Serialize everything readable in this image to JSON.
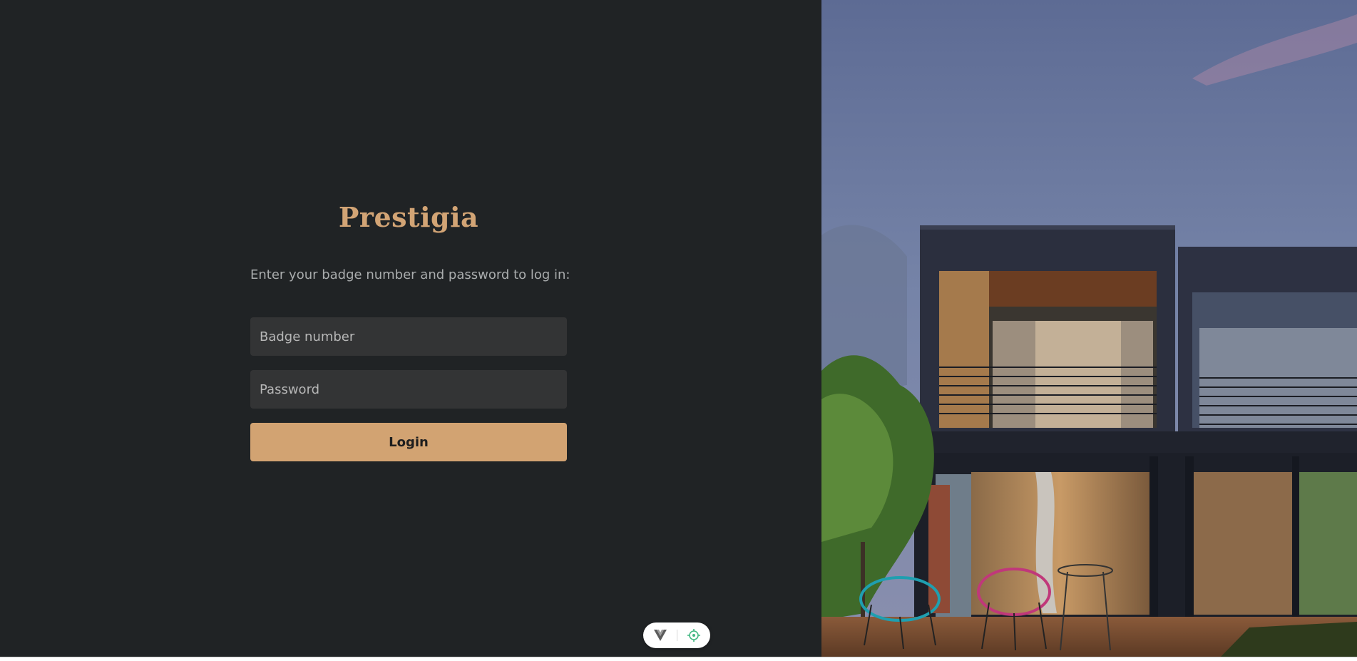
{
  "brand": {
    "name": "Prestigia",
    "color": "#d2a475"
  },
  "login": {
    "instructions": "Enter your badge number and password to log in:",
    "badge_placeholder": "Badge number",
    "badge_value": "",
    "password_placeholder": "Password",
    "password_value": "",
    "button_label": "Login",
    "button_color": "#d2a372"
  },
  "hero_image": {
    "description_icon": "modern-house-photo",
    "alt": "Modern two-storey house at dusk"
  },
  "dev_toolbar": {
    "icons": [
      "vue-devtools-icon",
      "crosshair-inspect-icon"
    ],
    "accent": "#42b883"
  },
  "colors": {
    "left_background": "#202325",
    "field_background": "#333435"
  }
}
